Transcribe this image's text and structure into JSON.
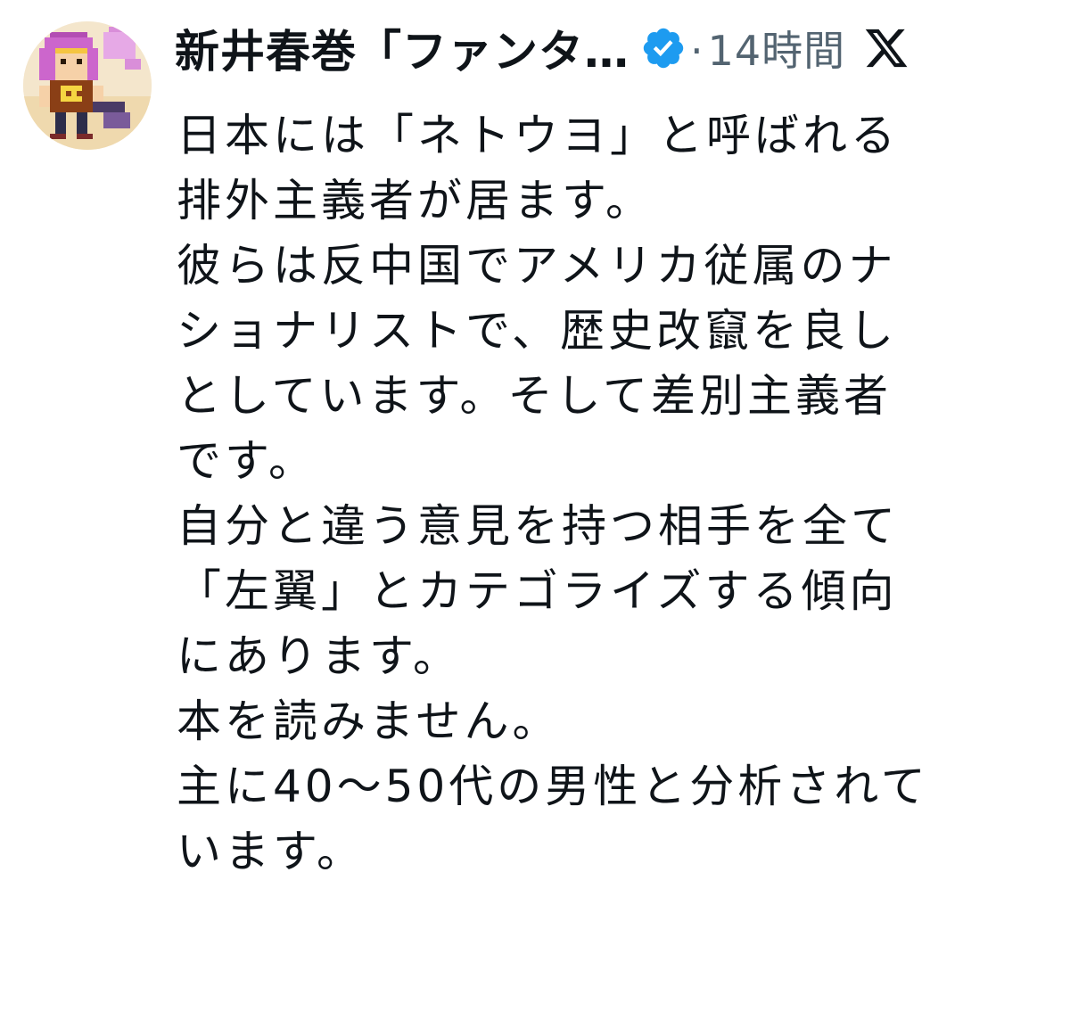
{
  "tweet": {
    "author": {
      "display_name": "新井春巻「ファンタ…",
      "verified": true,
      "avatar_icon": "pixel-art-character-avatar"
    },
    "meta": {
      "separator": "·",
      "time": "14時間"
    },
    "platform_icon": "x-logo-icon",
    "lines": [
      "日本には「ネトウヨ」と呼ばれる",
      "排外主義者が居ます。",
      "彼らは反中国でアメリカ従属のナ",
      "ショナリストで、歴史改竄を良し",
      "としています。そして差別主義者",
      "です。",
      "自分と違う意見を持つ相手を全て",
      "「左翼」とカテゴライズする傾向",
      "にあります。",
      "本を読みません。",
      "主に40～50代の男性と分析されて",
      "います。"
    ]
  },
  "colors": {
    "text": "#0f1419",
    "meta": "#536471",
    "verified_badge": "#1d9bf0"
  }
}
